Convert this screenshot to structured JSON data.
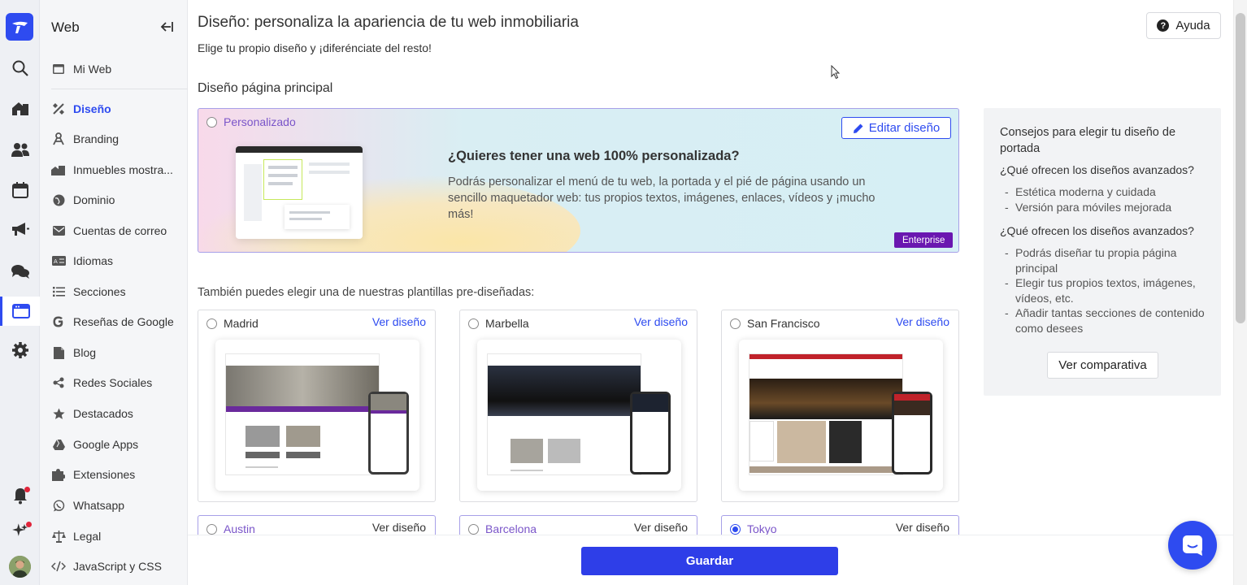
{
  "sidebar": {
    "title": "Web",
    "items": [
      {
        "label": "Mi Web",
        "icon": "web-icon"
      },
      {
        "label": "Diseño",
        "icon": "design-icon"
      },
      {
        "label": "Branding",
        "icon": "branding-icon"
      },
      {
        "label": "Inmuebles mostra...",
        "icon": "properties-icon"
      },
      {
        "label": "Dominio",
        "icon": "globe-icon"
      },
      {
        "label": "Cuentas de correo",
        "icon": "mail-icon"
      },
      {
        "label": "Idiomas",
        "icon": "language-icon"
      },
      {
        "label": "Secciones",
        "icon": "list-icon"
      },
      {
        "label": "Reseñas de Google",
        "icon": "google-icon"
      },
      {
        "label": "Blog",
        "icon": "blog-icon"
      },
      {
        "label": "Redes Sociales",
        "icon": "share-icon"
      },
      {
        "label": "Destacados",
        "icon": "star-icon"
      },
      {
        "label": "Google Apps",
        "icon": "google-drive-icon"
      },
      {
        "label": "Extensiones",
        "icon": "puzzle-icon"
      },
      {
        "label": "Whatsapp",
        "icon": "whatsapp-icon"
      },
      {
        "label": "Legal",
        "icon": "scale-icon"
      },
      {
        "label": "JavaScript y CSS",
        "icon": "code-icon"
      }
    ]
  },
  "header": {
    "title": "Diseño: personaliza la apariencia de tu web inmobiliaria",
    "subtitle": "Elige tu propio diseño y ¡diferénciate del resto!",
    "help_label": "Ayuda"
  },
  "main_section": {
    "title": "Diseño página principal",
    "custom_option": "Personalizado",
    "edit_label": "Editar diseño",
    "promo_title": "¿Quieres tener una web 100% personalizada?",
    "promo_text": "Podrás personalizar el menú de tu web, la portada y el pié de página usando un sencillo maquetador web: tus propios textos, imágenes, enlaces, vídeos y ¡mucho más!",
    "badge": "Enterprise"
  },
  "templates_intro": "También puedes elegir una de nuestras plantillas pre-diseñadas:",
  "view_label": "Ver diseño",
  "templates": [
    {
      "name": "Madrid",
      "selected": false,
      "accent": "#6a2a9c"
    },
    {
      "name": "Marbella",
      "selected": false,
      "accent": "#1d2330"
    },
    {
      "name": "San Francisco",
      "selected": false,
      "accent": "#c0222a"
    },
    {
      "name": "Austin",
      "selected": false
    },
    {
      "name": "Barcelona",
      "selected": false
    },
    {
      "name": "Tokyo",
      "selected": true
    }
  ],
  "tips": {
    "title": "Consejos para elegir tu diseño de portada",
    "q1": "¿Qué ofrecen los diseños avanzados?",
    "list1": [
      "Estética moderna y cuidada",
      "Versión para móviles mejorada"
    ],
    "q2": "¿Qué ofrecen los diseños avanzados?",
    "list2": [
      "Podrás diseñar tu propia página principal",
      "Elegir tus propios textos, imágenes, vídeos, etc.",
      "Añadir tantas secciones de contenido como desees"
    ],
    "compare_label": "Ver comparativa"
  },
  "footer": {
    "save_label": "Guardar"
  },
  "colors": {
    "brand": "#2e4bf0",
    "enterprise": "#6a17b0"
  }
}
